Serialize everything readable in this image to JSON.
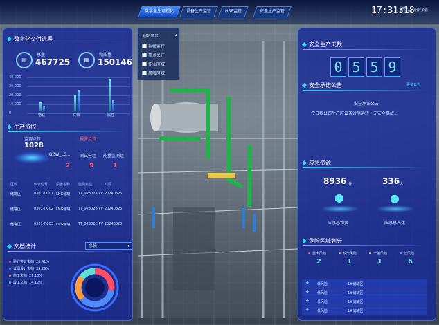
{
  "topbar": {
    "nav": [
      "数字全生可视化",
      "设备生产监管",
      "HSE监管",
      "安全生产监管"
    ],
    "time": "17:31:18",
    "date_line1": "星期日",
    "date_line2": "2024/4/07",
    "weather": "阴转多云"
  },
  "left": {
    "delivery": {
      "title": "数字化交付进展",
      "total_label": "总量",
      "total_value": "467725",
      "done_label": "完成量",
      "done_value": "150146",
      "ylabels": [
        "40,000",
        "30,000",
        "20,000",
        "10,000",
        "0"
      ],
      "categories": [
        "物联",
        "文档",
        "属性"
      ],
      "total_bars": [
        0.25,
        0.45,
        0.9
      ],
      "done_bars": [
        0.15,
        0.6,
        0.3
      ]
    },
    "monitor": {
      "title": "生产监控",
      "points_label": "监测点位",
      "points_value": "1028",
      "alarm_label": "报警点位",
      "cols": [
        "JGZW_LC...",
        "测试分组",
        "能量监测组"
      ],
      "col_values": [
        "2",
        "9",
        "1"
      ],
      "table_headers": [
        "区域",
        "仪表位号",
        "设备名称",
        "监测点位",
        "时间"
      ],
      "rows": [
        [
          "储罐区",
          "0301-TK-01",
          "LNG储罐",
          "TT_92302A.PV",
          "20240325"
        ],
        [
          "储罐区",
          "0301-TK-02",
          "LNG储罐",
          "TT_92302B.PV",
          "20240325"
        ],
        [
          "储罐区",
          "0301-TK-03",
          "LNG储罐",
          "TT_92302C.PV",
          "20240325"
        ]
      ]
    },
    "docs": {
      "title": "文档统计",
      "select": "总装",
      "legend": [
        {
          "label": "验收签证文档",
          "pct": "26.41%",
          "color": "#ff4d6a"
        },
        {
          "label": "详细设计文档",
          "pct": "35.29%",
          "color": "#4f8bff"
        },
        {
          "label": "施工文档",
          "pct": "21.18%",
          "color": "#ff9a3d"
        },
        {
          "label": "竣工文档",
          "pct": "14.12%",
          "color": "#5ee0d8"
        }
      ]
    }
  },
  "layers": {
    "title": "地图显示",
    "items": [
      {
        "label": "视频监控",
        "checked": true
      },
      {
        "label": "重点关注",
        "checked": true
      },
      {
        "label": "作业区域",
        "checked": false
      },
      {
        "label": "风险区域",
        "checked": false
      }
    ]
  },
  "right": {
    "days": {
      "title": "安全生产天数",
      "digits": [
        "0",
        "5",
        "5",
        "9"
      ]
    },
    "notice": {
      "title": "安全承诺公告",
      "more": "更多公告",
      "head": "安全承诺公告",
      "body": "今日我公司生产区设备设施运转，无安全事故..."
    },
    "resources": {
      "title": "应急资源",
      "supplies_value": "8936",
      "supplies_unit": "件",
      "supplies_label": "应急总物资",
      "people_value": "336",
      "people_unit": "人",
      "people_label": "应急总人数"
    },
    "risk": {
      "title": "危险区域划分",
      "levels": [
        {
          "label": "重大风险",
          "value": "2",
          "color": "#ff4d4d"
        },
        {
          "label": "较大风险",
          "value": "1",
          "color": "#ff9a3d"
        },
        {
          "label": "一般风险",
          "value": "1",
          "color": "#ffe14d"
        },
        {
          "label": "低风险",
          "value": "6",
          "color": "#4fa8ff"
        }
      ],
      "rows": [
        [
          "低风险",
          "1#储罐区"
        ],
        [
          "低风险",
          "1#储罐区"
        ],
        [
          "低风险",
          "1#储罐区"
        ],
        [
          "低风险",
          "1#储罐区"
        ]
      ]
    }
  },
  "colors": {
    "accent": "#38d6ff",
    "panel": "#1628a0",
    "active_tab": "#2f6fff"
  }
}
